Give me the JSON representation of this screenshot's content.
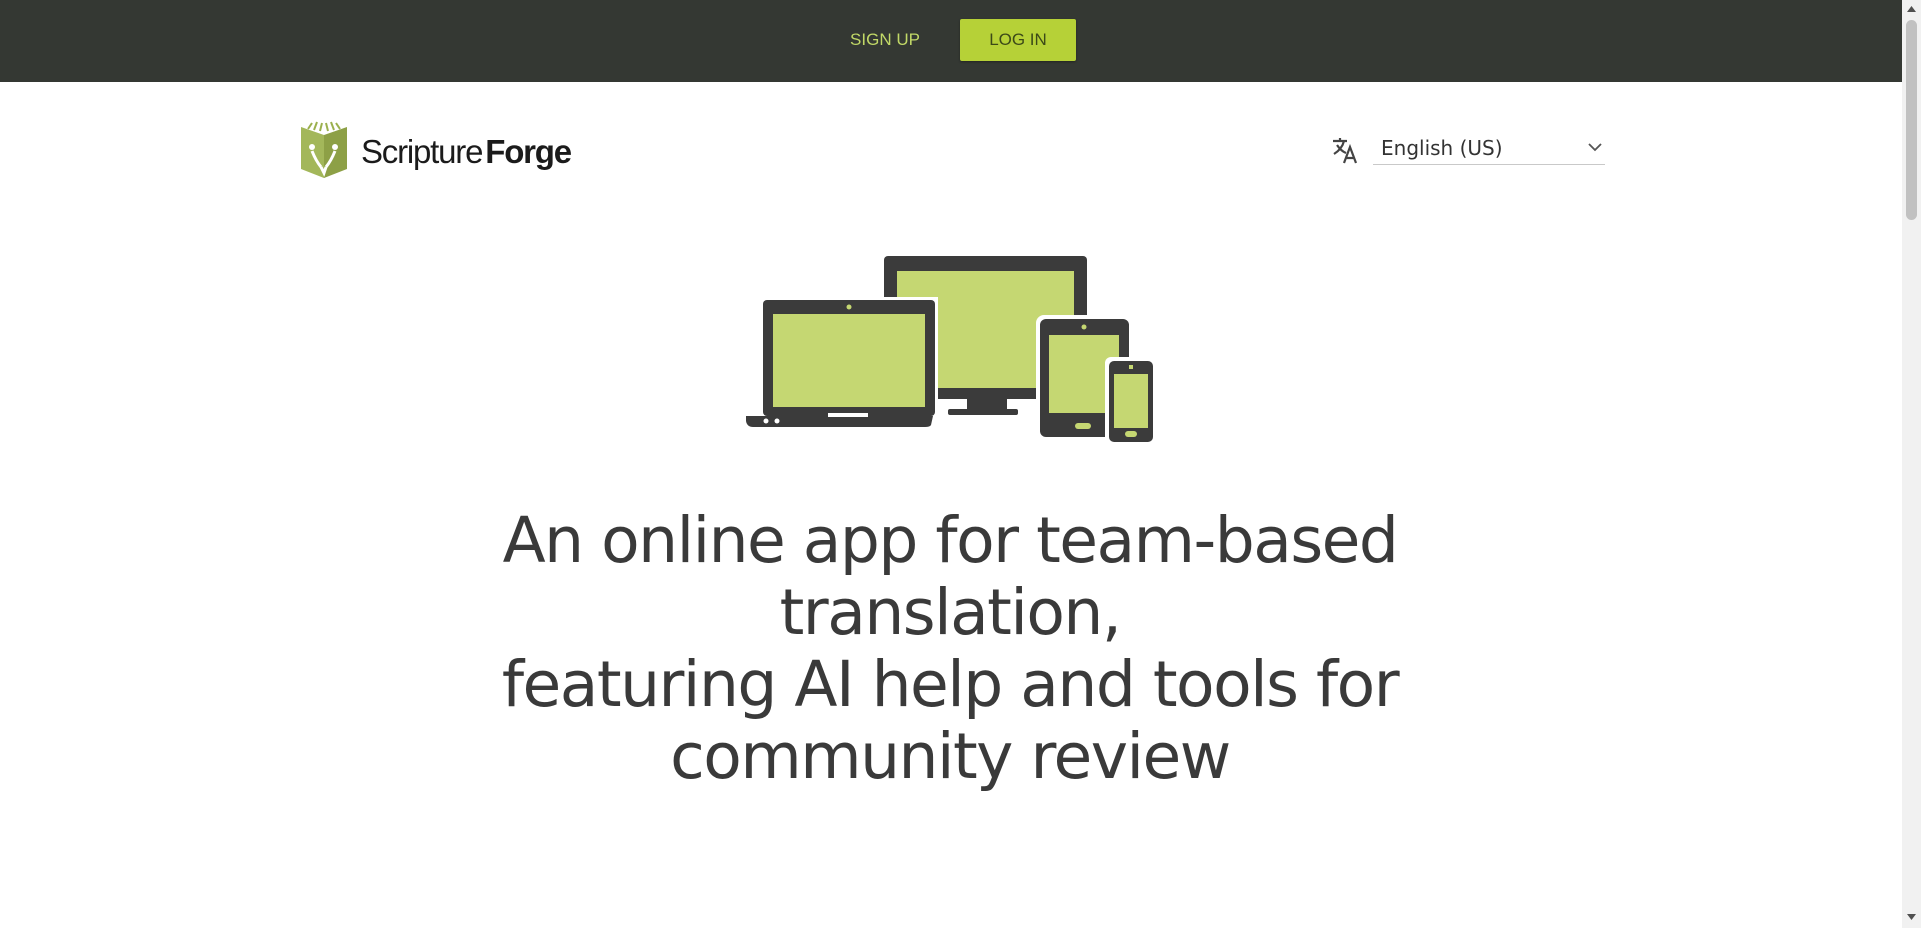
{
  "topbar": {
    "signup_label": "SIGN UP",
    "login_label": "LOG IN"
  },
  "logo": {
    "name_light": "Scripture",
    "name_bold": "Forge"
  },
  "language": {
    "icon": "translate-icon",
    "selected": "English (US)"
  },
  "hero": {
    "illustration": "devices-illustration",
    "headline_lines": [
      "An online app for team-based translation,",
      "featuring AI help and tools for",
      "community review"
    ]
  },
  "colors": {
    "topbar": "#343833",
    "accent": "#b6d137",
    "screen": "#c5d772",
    "device": "#3b3b3b"
  }
}
